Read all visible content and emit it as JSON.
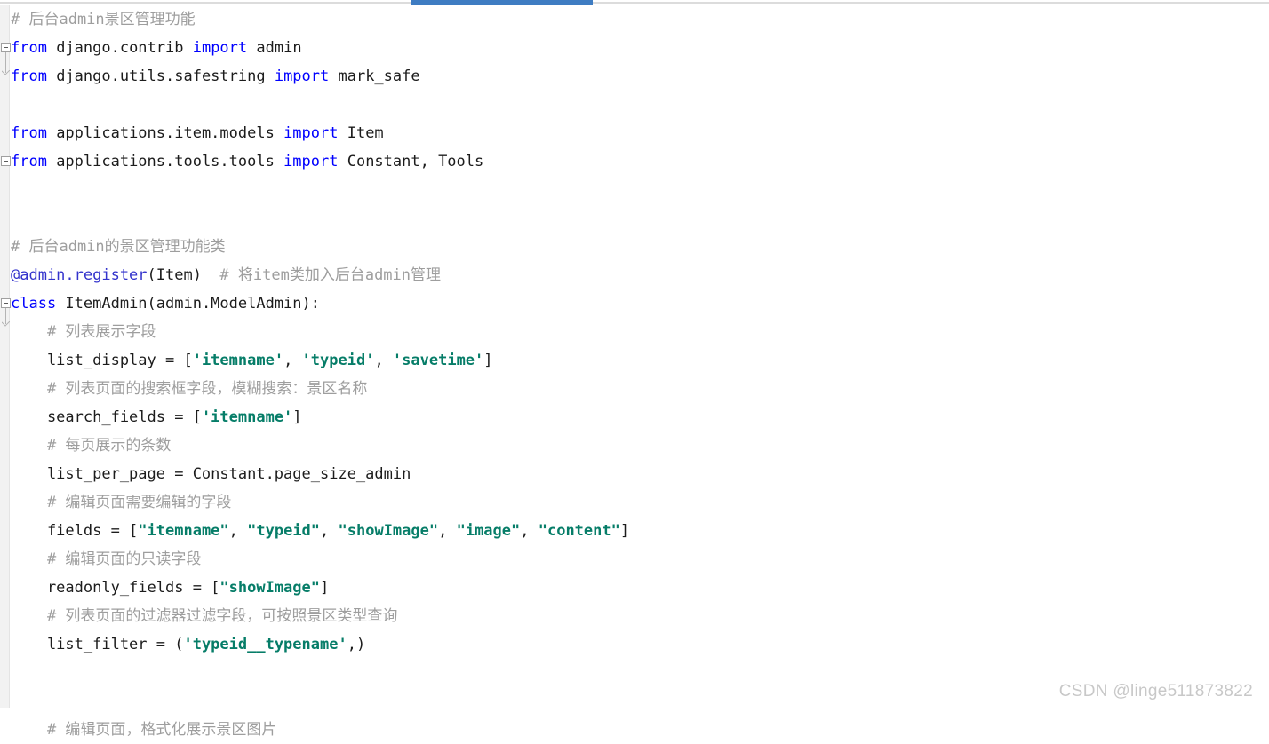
{
  "window": {
    "app": "code-editor",
    "language": "Python",
    "background_color": "#ffffff"
  },
  "tab_bar": {
    "active_tab_accent_color": "#3e7cc2",
    "track_color": "#dcdcdc"
  },
  "gutter": {
    "background_color": "#f2f2f2",
    "fold_markers": [
      {
        "label": "−",
        "line_index": 1
      },
      {
        "label": "−",
        "line_index": 4
      },
      {
        "label": "−",
        "line_index": 9
      }
    ]
  },
  "syntax_colors": {
    "keyword": "#0000ff",
    "decorator": "#3333cc",
    "string": "#067d68",
    "comment": "#9e9e9e",
    "plain": "#1c1c1c"
  },
  "code": {
    "lines": [
      {
        "n": 1,
        "tokens": [
          {
            "t": "comment",
            "v": "# 后台admin景区管理功能"
          }
        ]
      },
      {
        "n": 2,
        "tokens": [
          {
            "t": "keyword",
            "v": "from"
          },
          {
            "t": "plain",
            "v": " django.contrib "
          },
          {
            "t": "keyword",
            "v": "import"
          },
          {
            "t": "plain",
            "v": " admin"
          }
        ]
      },
      {
        "n": 3,
        "tokens": [
          {
            "t": "keyword",
            "v": "from"
          },
          {
            "t": "plain",
            "v": " django.utils.safestring "
          },
          {
            "t": "keyword",
            "v": "import"
          },
          {
            "t": "plain",
            "v": " mark_safe"
          }
        ]
      },
      {
        "n": 4,
        "tokens": []
      },
      {
        "n": 5,
        "tokens": [
          {
            "t": "keyword",
            "v": "from"
          },
          {
            "t": "plain",
            "v": " applications.item.models "
          },
          {
            "t": "keyword",
            "v": "import"
          },
          {
            "t": "plain",
            "v": " Item"
          }
        ]
      },
      {
        "n": 6,
        "tokens": [
          {
            "t": "keyword",
            "v": "from"
          },
          {
            "t": "plain",
            "v": " applications.tools.tools "
          },
          {
            "t": "keyword",
            "v": "import"
          },
          {
            "t": "plain",
            "v": " Constant, Tools"
          }
        ]
      },
      {
        "n": 7,
        "tokens": []
      },
      {
        "n": 8,
        "tokens": []
      },
      {
        "n": 9,
        "tokens": [
          {
            "t": "comment",
            "v": "# 后台admin的景区管理功能类"
          }
        ]
      },
      {
        "n": 10,
        "tokens": [
          {
            "t": "decorator",
            "v": "@admin.register"
          },
          {
            "t": "plain",
            "v": "(Item)"
          },
          {
            "t": "comment",
            "v": "  # 将item类加入后台admin管理"
          }
        ]
      },
      {
        "n": 11,
        "tokens": [
          {
            "t": "keyword",
            "v": "class"
          },
          {
            "t": "plain",
            "v": " ItemAdmin(admin.ModelAdmin):"
          }
        ]
      },
      {
        "n": 12,
        "tokens": [
          {
            "t": "comment",
            "v": "    # 列表展示字段"
          }
        ]
      },
      {
        "n": 13,
        "tokens": [
          {
            "t": "plain",
            "v": "    list_display = ["
          },
          {
            "t": "string",
            "v": "'itemname'"
          },
          {
            "t": "plain",
            "v": ", "
          },
          {
            "t": "string",
            "v": "'typeid'"
          },
          {
            "t": "plain",
            "v": ", "
          },
          {
            "t": "string",
            "v": "'savetime'"
          },
          {
            "t": "plain",
            "v": "]"
          }
        ]
      },
      {
        "n": 14,
        "tokens": [
          {
            "t": "comment",
            "v": "    # 列表页面的搜索框字段，模糊搜索：景区名称"
          }
        ]
      },
      {
        "n": 15,
        "tokens": [
          {
            "t": "plain",
            "v": "    search_fields = ["
          },
          {
            "t": "string",
            "v": "'itemname'"
          },
          {
            "t": "plain",
            "v": "]"
          }
        ]
      },
      {
        "n": 16,
        "tokens": [
          {
            "t": "comment",
            "v": "    # 每页展示的条数"
          }
        ]
      },
      {
        "n": 17,
        "tokens": [
          {
            "t": "plain",
            "v": "    list_per_page = Constant.page_size_admin"
          }
        ]
      },
      {
        "n": 18,
        "tokens": [
          {
            "t": "comment",
            "v": "    # 编辑页面需要编辑的字段"
          }
        ]
      },
      {
        "n": 19,
        "tokens": [
          {
            "t": "plain",
            "v": "    fields = ["
          },
          {
            "t": "string",
            "v": "\"itemname\""
          },
          {
            "t": "plain",
            "v": ", "
          },
          {
            "t": "string",
            "v": "\"typeid\""
          },
          {
            "t": "plain",
            "v": ", "
          },
          {
            "t": "string",
            "v": "\"showImage\""
          },
          {
            "t": "plain",
            "v": ", "
          },
          {
            "t": "string",
            "v": "\"image\""
          },
          {
            "t": "plain",
            "v": ", "
          },
          {
            "t": "string",
            "v": "\"content\""
          },
          {
            "t": "plain",
            "v": "]"
          }
        ]
      },
      {
        "n": 20,
        "tokens": [
          {
            "t": "comment",
            "v": "    # 编辑页面的只读字段"
          }
        ]
      },
      {
        "n": 21,
        "tokens": [
          {
            "t": "plain",
            "v": "    readonly_fields = ["
          },
          {
            "t": "string",
            "v": "\"showImage\""
          },
          {
            "t": "plain",
            "v": "]"
          }
        ]
      },
      {
        "n": 22,
        "tokens": [
          {
            "t": "comment",
            "v": "    # 列表页面的过滤器过滤字段，可按照景区类型查询"
          }
        ]
      },
      {
        "n": 23,
        "tokens": [
          {
            "t": "plain",
            "v": "    list_filter = ("
          },
          {
            "t": "string",
            "v": "'typeid__typename'"
          },
          {
            "t": "plain",
            "v": ",)"
          }
        ]
      },
      {
        "n": 24,
        "tokens": []
      },
      {
        "n": 25,
        "tokens": []
      },
      {
        "n": 26,
        "tokens": [
          {
            "t": "comment",
            "v": "    # 编辑页面，格式化展示景区图片"
          }
        ]
      }
    ]
  },
  "watermark": {
    "text": "CSDN @linge511873822",
    "color": "#c8c8c8"
  }
}
